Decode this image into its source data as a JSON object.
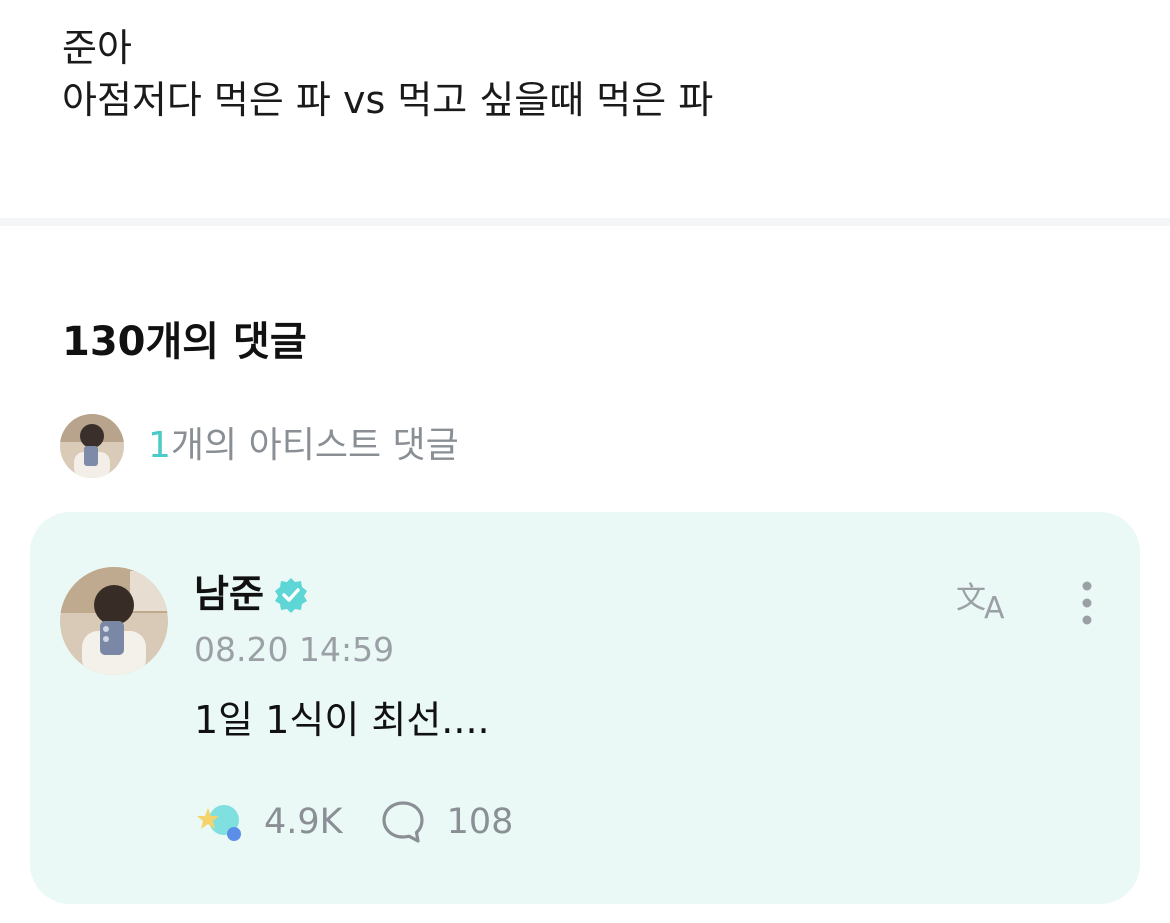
{
  "post": {
    "line1": "준아",
    "line2": "아점저다 먹은 파 vs 먹고 싶을때 먹은 파"
  },
  "comments": {
    "header": "130개의 댓글",
    "artist_summary": {
      "count": "1",
      "text": "개의 아티스트 댓글"
    },
    "items": [
      {
        "author": "남준",
        "verified_icon": "verified-badge-icon",
        "timestamp": "08.20 14:59",
        "text": "1일 1식이 최선....",
        "likes": "4.9K",
        "replies": "108"
      }
    ]
  },
  "colors": {
    "accent": "#4cc9c9",
    "card_background": "#ebf9f6",
    "muted_text": "#8a8f95",
    "verified": "#5fd6d6"
  },
  "icons": {
    "translate": "translate-icon",
    "more": "more-vertical-icon",
    "like": "star-reaction-icon",
    "reply": "speech-bubble-icon"
  }
}
